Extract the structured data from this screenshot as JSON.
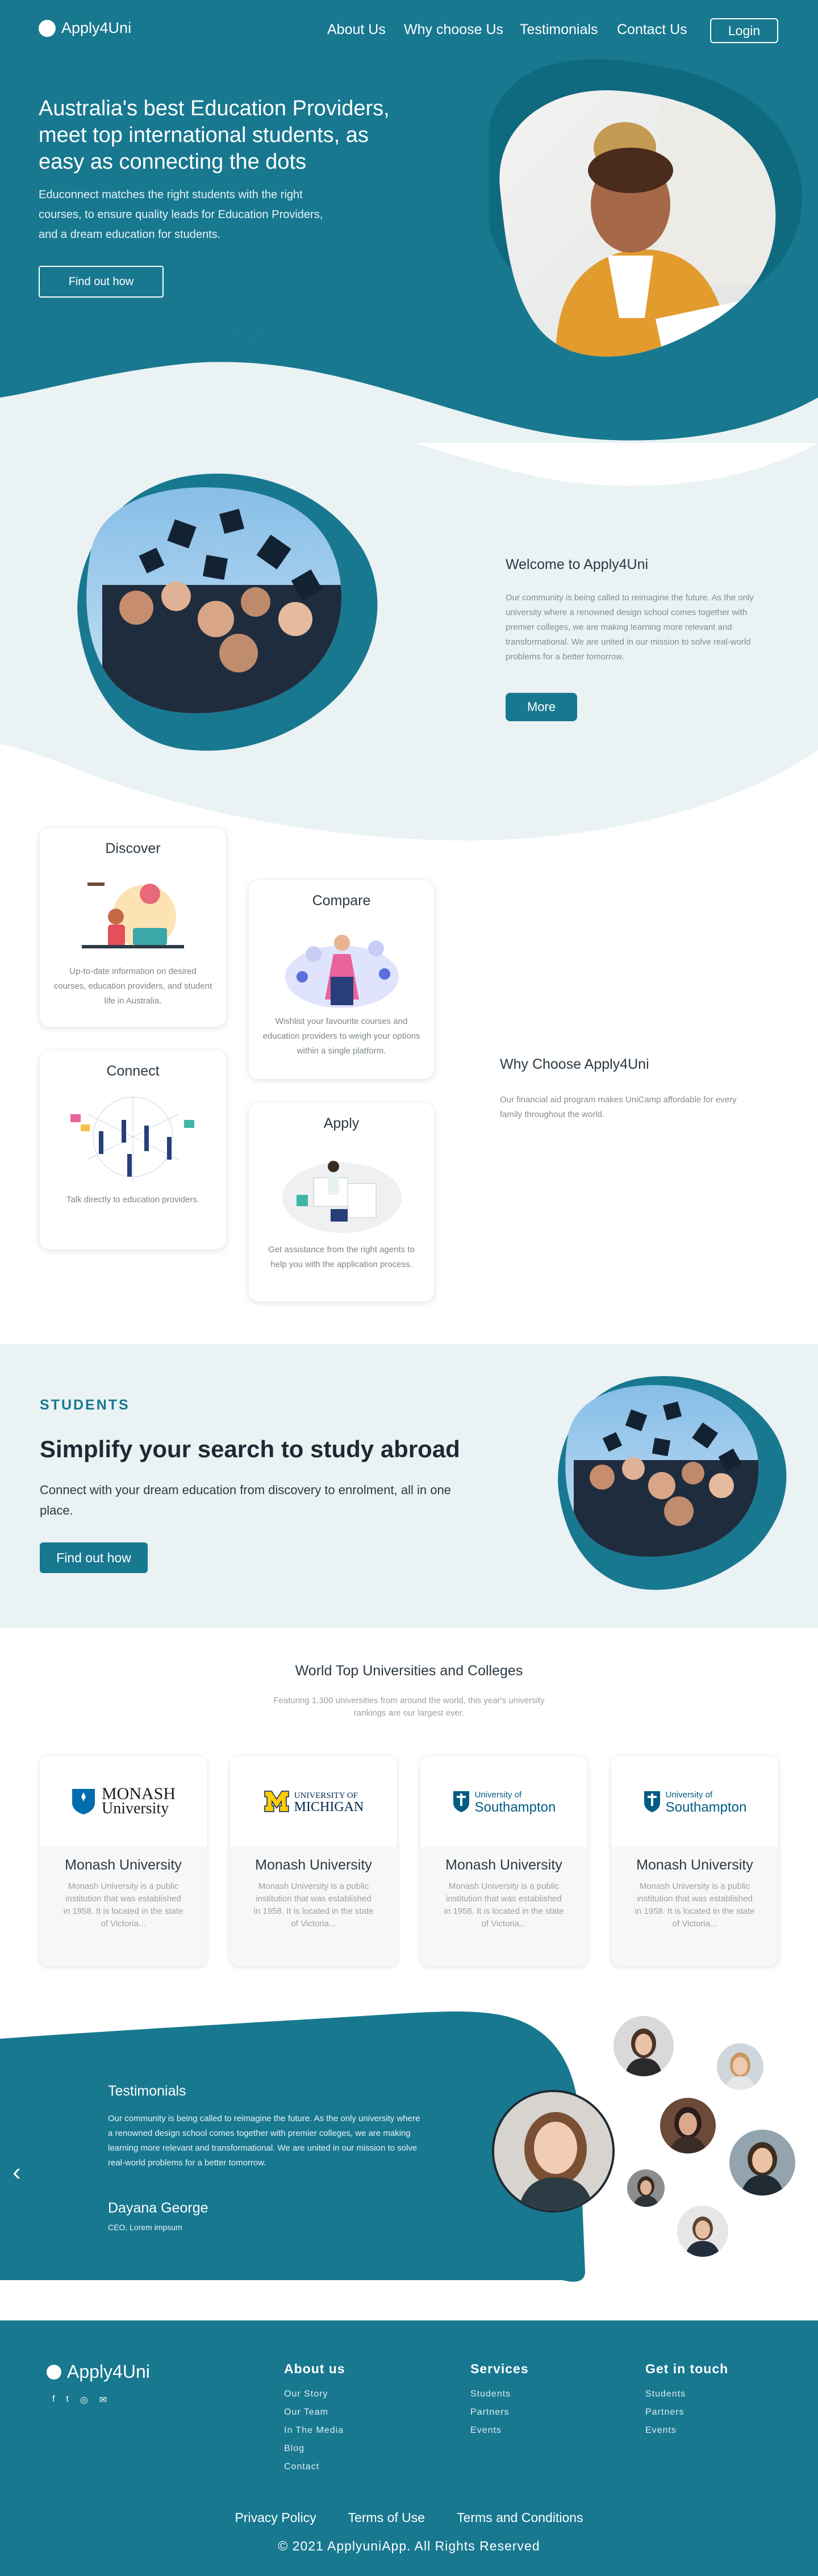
{
  "brand": {
    "name": "Apply4Uni"
  },
  "nav": {
    "items": [
      "About Us",
      "Why choose Us",
      "Testimonials",
      "Contact Us"
    ],
    "login": "Login"
  },
  "hero": {
    "title_line1": "Australia's best Education Providers,",
    "title_line2": "meet top international students, as",
    "title_line3": "easy as connecting the dots",
    "text_line1": "Educonnect matches the right students with the right",
    "text_line2": "courses, to ensure quality leads for Education Providers,",
    "text_line3": "and a dream education for students.",
    "cta": "Find out how"
  },
  "welcome": {
    "title": "Welcome to Apply4Uni",
    "text": "Our community is being called to reimagine the future. As the only university where a renowned design school comes together with premier colleges, we are making learning more relevant and transformational.   We are united in our mission to solve real-world problems for a better tomorrow.",
    "button": "More"
  },
  "features": {
    "cards": [
      {
        "title": "Discover",
        "text": "Up-to-date information on desired courses, education providers, and student life in Australia."
      },
      {
        "title": "Compare",
        "text": "Wishlist your favourite courses and education providers to weigh your options within a single platform."
      },
      {
        "title": "Connect",
        "text": "Talk directly to education providers."
      },
      {
        "title": "Apply",
        "text": "Get assistance from the right agents to help you with the application process."
      }
    ],
    "why_title": "Why Choose Apply4Uni",
    "why_text": "Our financial aid program makes UniCamp affordable for every family throughout the world."
  },
  "students": {
    "label": "STUDENTS",
    "title": "Simplify your search to study abroad",
    "text": "Connect with your dream education from discovery to enrolment, all in one place.",
    "button": "Find out how"
  },
  "universities": {
    "title": "World Top Universities and Colleges",
    "subtitle": "Featuring 1,300 universities from around the world, this year's university rankings are our largest ever.",
    "cards": [
      {
        "logo_line1": "MONASH",
        "logo_line2": "University",
        "name": "Monash University",
        "desc": "Monash University is a public institution that was established in 1958. It is located in the state of Victoria..."
      },
      {
        "logo_line1": "UNIVERSITY OF",
        "logo_line2": "MICHIGAN",
        "name": "Monash University",
        "desc": "Monash University is a public institution that was established in 1958. It is located in the state of Victoria..."
      },
      {
        "logo_line1": "University of",
        "logo_line2": "Southampton",
        "name": "Monash University",
        "desc": "Monash University is a public institution that was established in 1958. It is located in the state of Victoria..."
      },
      {
        "logo_line1": "University of",
        "logo_line2": "Southampton",
        "name": "Monash University",
        "desc": "Monash University is a public institution that was established in 1958. It is located in the state of Victoria..."
      }
    ]
  },
  "testimonials": {
    "title": "Testimonials",
    "text": "Our community is being called to reimagine the future. As the only university where a renowned design school comes together with premier colleges, we are making learning more relevant and transformational. We are united in our mission to solve real-world problems for a better tomorrow.",
    "name": "Dayana George",
    "role": "CEO, Lorem impsum",
    "prev_icon": "chevron-left-icon"
  },
  "footer": {
    "brand": "Apply4Uni",
    "social_icons": [
      "facebook-icon",
      "twitter-icon",
      "instagram-icon",
      "mail-icon"
    ],
    "columns": [
      {
        "title": "About us",
        "links": [
          "Our Story",
          "Our Team",
          "In The Media",
          "Blog",
          "Contact"
        ]
      },
      {
        "title": "Services",
        "links": [
          "Students",
          "Partners",
          "Events"
        ]
      },
      {
        "title": "Get in touch",
        "links": [
          "Students",
          "Partners",
          "Events"
        ]
      }
    ],
    "bottom_links": [
      "Privacy Policy",
      "Terms of Use",
      "Terms and Conditions"
    ],
    "copyright": "© 2021 ApplyuniApp. All Rights Reserved"
  },
  "colors": {
    "primary": "#187890",
    "light_bg": "#eaf2f4",
    "dark_teal": "#0f6a80"
  }
}
